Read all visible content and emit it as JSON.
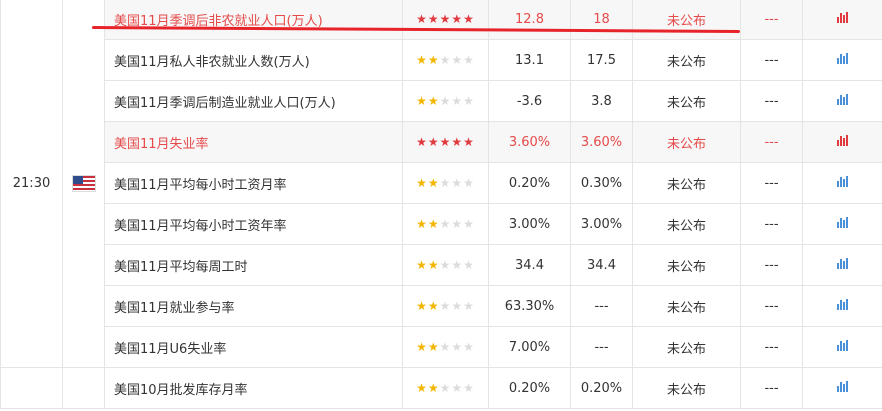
{
  "time": "21:30",
  "country_flag": "us-flag-icon",
  "dash": "---",
  "rows": [
    {
      "name": "美国11月季调后非农就业人口(万人)",
      "stars": 5,
      "previous": "12.8",
      "forecast": "18",
      "actual": "未公布",
      "impact": "---",
      "highlight": true
    },
    {
      "name": "美国11月私人非农就业人数(万人)",
      "stars": 2,
      "previous": "13.1",
      "forecast": "17.5",
      "actual": "未公布",
      "impact": "---",
      "highlight": false
    },
    {
      "name": "美国11月季调后制造业就业人口(万人)",
      "stars": 2,
      "previous": "-3.6",
      "forecast": "3.8",
      "actual": "未公布",
      "impact": "---",
      "highlight": false
    },
    {
      "name": "美国11月失业率",
      "stars": 5,
      "previous": "3.60%",
      "forecast": "3.60%",
      "actual": "未公布",
      "impact": "---",
      "highlight": true
    },
    {
      "name": "美国11月平均每小时工资月率",
      "stars": 2,
      "previous": "0.20%",
      "forecast": "0.30%",
      "actual": "未公布",
      "impact": "---",
      "highlight": false
    },
    {
      "name": "美国11月平均每小时工资年率",
      "stars": 2,
      "previous": "3.00%",
      "forecast": "3.00%",
      "actual": "未公布",
      "impact": "---",
      "highlight": false
    },
    {
      "name": "美国11月平均每周工时",
      "stars": 2,
      "previous": "34.4",
      "forecast": "34.4",
      "actual": "未公布",
      "impact": "---",
      "highlight": false
    },
    {
      "name": "美国11月就业参与率",
      "stars": 2,
      "previous": "63.30%",
      "forecast": "---",
      "actual": "未公布",
      "impact": "---",
      "highlight": false
    },
    {
      "name": "美国11月U6失业率",
      "stars": 2,
      "previous": "7.00%",
      "forecast": "---",
      "actual": "未公布",
      "impact": "---",
      "highlight": false
    },
    {
      "name": "美国10月批发库存月率",
      "stars": 2,
      "previous": "0.20%",
      "forecast": "0.20%",
      "actual": "未公布",
      "impact": "---",
      "highlight": false
    }
  ],
  "colors": {
    "highlight_text": "#e64a4a",
    "star_gold": "#f2b600",
    "star_red": "#e0393e",
    "star_empty": "#dcdcdc",
    "chart_blue": "#4a90d9",
    "chart_red": "#e0393e",
    "annotation_line": "#e8242b"
  }
}
